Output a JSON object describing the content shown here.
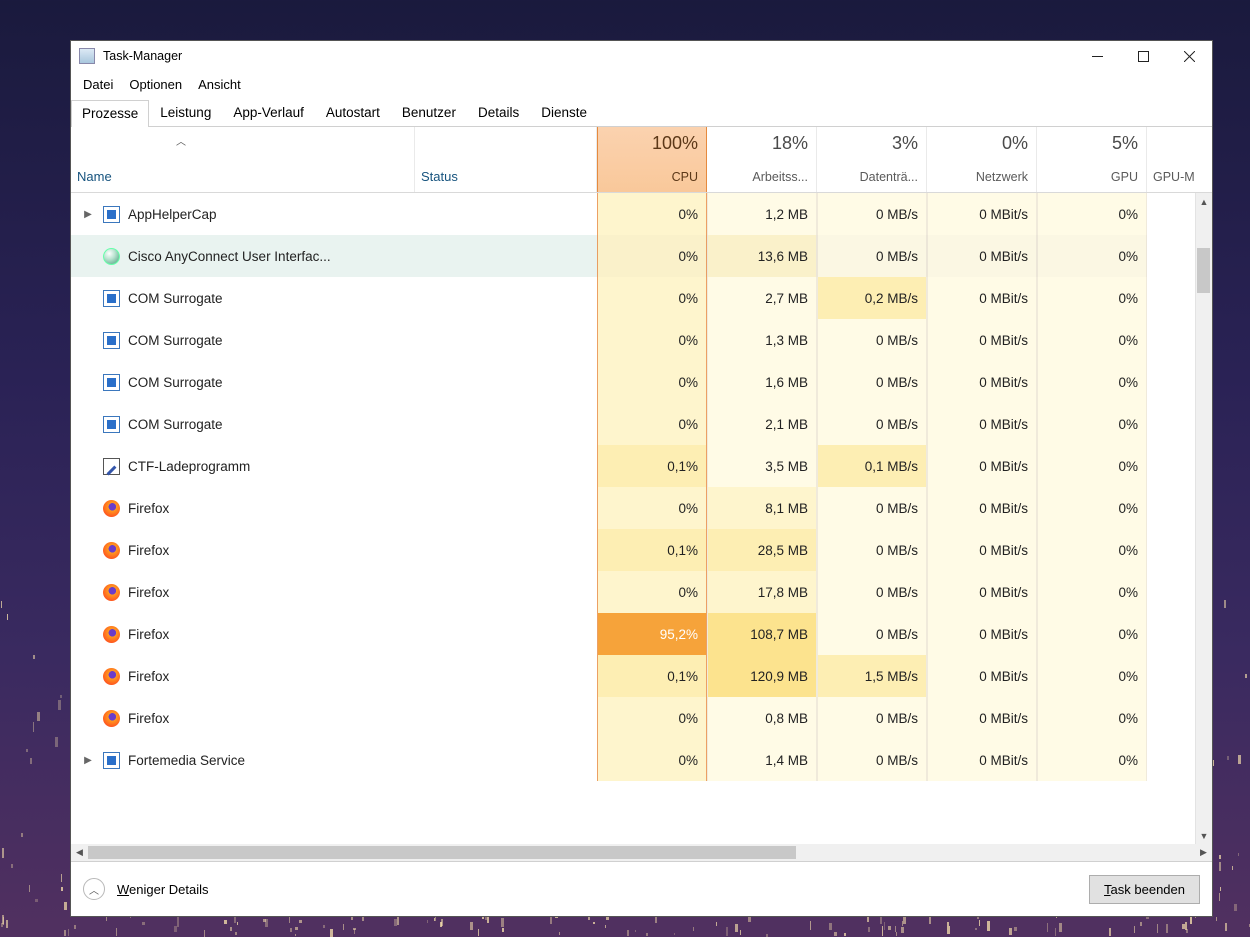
{
  "window": {
    "title": "Task-Manager"
  },
  "menu": {
    "datei": "Datei",
    "optionen": "Optionen",
    "ansicht": "Ansicht"
  },
  "tabs": {
    "prozesse": "Prozesse",
    "leistung": "Leistung",
    "appverlauf": "App-Verlauf",
    "autostart": "Autostart",
    "benutzer": "Benutzer",
    "details": "Details",
    "dienste": "Dienste"
  },
  "columns": {
    "name": "Name",
    "status": "Status",
    "cpu": {
      "pct": "100%",
      "label": "CPU"
    },
    "mem": {
      "pct": "18%",
      "label": "Arbeitss..."
    },
    "disk": {
      "pct": "3%",
      "label": "Datenträ..."
    },
    "net": {
      "pct": "0%",
      "label": "Netzwerk"
    },
    "gpu": {
      "pct": "5%",
      "label": "GPU"
    },
    "gpum": "GPU-M"
  },
  "rows": [
    {
      "expand": true,
      "icon": "win",
      "name": "AppHelperCap",
      "cpu": "0%",
      "mem": "1,2 MB",
      "disk": "0 MB/s",
      "net": "0 MBit/s",
      "gpu": "0%"
    },
    {
      "selected": true,
      "icon": "globe",
      "name": "Cisco AnyConnect User Interfac...",
      "cpu": "0%",
      "mem": "13,6 MB",
      "disk": "0 MB/s",
      "net": "0 MBit/s",
      "gpu": "0%"
    },
    {
      "icon": "win",
      "name": "COM Surrogate",
      "cpu": "0%",
      "mem": "2,7 MB",
      "disk": "0,2 MB/s",
      "net": "0 MBit/s",
      "gpu": "0%"
    },
    {
      "icon": "win",
      "name": "COM Surrogate",
      "cpu": "0%",
      "mem": "1,3 MB",
      "disk": "0 MB/s",
      "net": "0 MBit/s",
      "gpu": "0%"
    },
    {
      "icon": "win",
      "name": "COM Surrogate",
      "cpu": "0%",
      "mem": "1,6 MB",
      "disk": "0 MB/s",
      "net": "0 MBit/s",
      "gpu": "0%"
    },
    {
      "icon": "win",
      "name": "COM Surrogate",
      "cpu": "0%",
      "mem": "2,1 MB",
      "disk": "0 MB/s",
      "net": "0 MBit/s",
      "gpu": "0%"
    },
    {
      "icon": "pen",
      "name": "CTF-Ladeprogramm",
      "cpu": "0,1%",
      "mem": "3,5 MB",
      "disk": "0,1 MB/s",
      "net": "0 MBit/s",
      "gpu": "0%"
    },
    {
      "icon": "ff",
      "name": "Firefox",
      "cpu": "0%",
      "mem": "8,1 MB",
      "disk": "0 MB/s",
      "net": "0 MBit/s",
      "gpu": "0%"
    },
    {
      "icon": "ff",
      "name": "Firefox",
      "cpu": "0,1%",
      "mem": "28,5 MB",
      "disk": "0 MB/s",
      "net": "0 MBit/s",
      "gpu": "0%"
    },
    {
      "icon": "ff",
      "name": "Firefox",
      "cpu": "0%",
      "mem": "17,8 MB",
      "disk": "0 MB/s",
      "net": "0 MBit/s",
      "gpu": "0%"
    },
    {
      "icon": "ff",
      "name": "Firefox",
      "cpu": "95,2%",
      "cpu_hot": true,
      "mem": "108,7 MB",
      "disk": "0 MB/s",
      "net": "0 MBit/s",
      "gpu": "0%"
    },
    {
      "icon": "ff",
      "name": "Firefox",
      "cpu": "0,1%",
      "mem": "120,9 MB",
      "disk": "1,5 MB/s",
      "net": "0 MBit/s",
      "gpu": "0%"
    },
    {
      "icon": "ff",
      "name": "Firefox",
      "cpu": "0%",
      "mem": "0,8 MB",
      "disk": "0 MB/s",
      "net": "0 MBit/s",
      "gpu": "0%"
    },
    {
      "expand": true,
      "icon": "win",
      "name": "Fortemedia Service",
      "cpu": "0%",
      "mem": "1,4 MB",
      "disk": "0 MB/s",
      "net": "0 MBit/s",
      "gpu": "0%"
    }
  ],
  "footer": {
    "fewer_u": "W",
    "fewer_rest": "eniger Details",
    "end_u": "T",
    "end_rest": "ask beenden"
  }
}
